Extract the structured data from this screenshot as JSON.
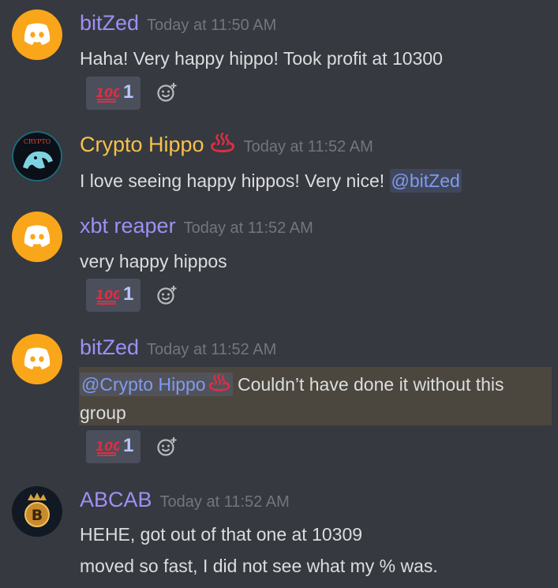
{
  "messages": [
    {
      "username": "bitZed",
      "timestamp": "Today at 11:50 AM",
      "lines": [
        "Haha! Very happy hippo! Took profit at 10300"
      ],
      "reaction": {
        "emoji": "100-points",
        "count": "1"
      }
    },
    {
      "username": "Crypto Hippo",
      "timestamp": "Today at 11:52 AM",
      "lines": [
        "I love seeing happy hippos! Very nice! "
      ],
      "mention": "@bitZed",
      "avatar_text": "CRYPTO"
    },
    {
      "username": "xbt reaper",
      "timestamp": "Today at 11:52 AM",
      "lines": [
        "very happy hippos"
      ],
      "reaction": {
        "emoji": "100-points",
        "count": "1"
      }
    },
    {
      "username": "bitZed",
      "timestamp": "Today at 11:52 AM",
      "mention": "@Crypto Hippo",
      "lines": [
        " Couldn’t have done it without this",
        "group"
      ],
      "reaction": {
        "emoji": "100-points",
        "count": "1"
      }
    },
    {
      "username": "ABCAB",
      "timestamp": "Today at 11:52 AM",
      "lines": [
        "HEHE, got out of that one at 10309",
        "moved so fast, I did not see what my % was."
      ]
    }
  ],
  "colors": {
    "background": "#36393f",
    "username_default": "#9f8ff6",
    "username_gold": "#f7c14b",
    "timestamp": "#72767d",
    "mention": "#7f9bf1",
    "highlight": "#4b473f",
    "reaction_bg": "#4a4f5b"
  },
  "icons": [
    "discord-logo-icon",
    "hot-springs-icon",
    "100-points-icon",
    "add-reaction-icon",
    "bitcoin-icon"
  ]
}
